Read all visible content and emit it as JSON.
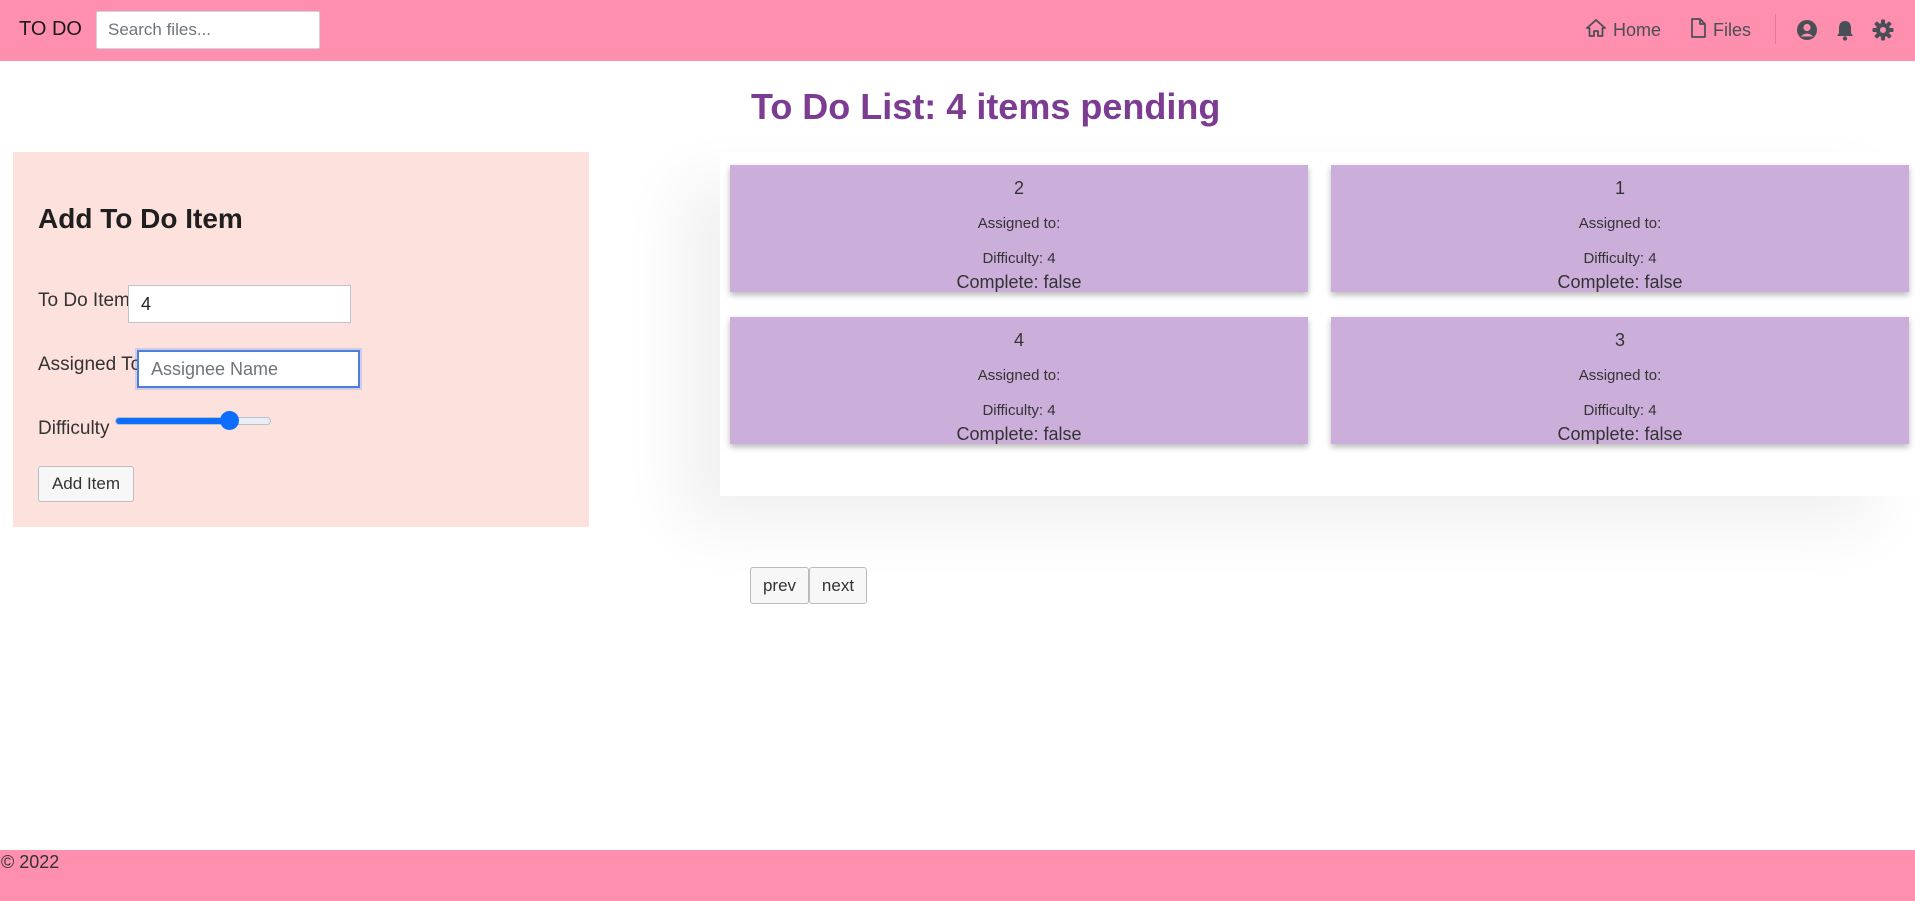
{
  "navbar": {
    "brand": "TO DO",
    "search_placeholder": "Search files...",
    "links": [
      {
        "label": "Home",
        "icon": "home-icon"
      },
      {
        "label": "Files",
        "icon": "file-icon"
      }
    ],
    "icons": [
      "user-circle-icon",
      "bell-icon",
      "gear-icon"
    ],
    "background": "#ff8fae"
  },
  "form": {
    "title": "Add To Do Item",
    "item_label": "To Do Item",
    "item_value": "4",
    "assigned_label": "Assigned To",
    "assigned_value": "",
    "assigned_placeholder": "Assignee Name",
    "difficulty_label": "Difficulty",
    "difficulty_fraction": 0.73,
    "add_button": "Add Item",
    "background": "#fde1dd"
  },
  "list": {
    "title": "To Do List: 4 items pending",
    "title_color": "#7b3c92",
    "card_color": "#ccaedb",
    "items": [
      {
        "text": "2",
        "assigned": "Assigned to:",
        "difficulty": "Difficulty: 4",
        "complete": "Complete: false"
      },
      {
        "text": "1",
        "assigned": "Assigned to:",
        "difficulty": "Difficulty: 4",
        "complete": "Complete: false"
      },
      {
        "text": "4",
        "assigned": "Assigned to:",
        "difficulty": "Difficulty: 4",
        "complete": "Complete: false"
      },
      {
        "text": "3",
        "assigned": "Assigned to:",
        "difficulty": "Difficulty: 4",
        "complete": "Complete: false"
      }
    ]
  },
  "pagination": {
    "prev": "prev",
    "next": "next"
  },
  "footer": {
    "text": "© 2022"
  }
}
